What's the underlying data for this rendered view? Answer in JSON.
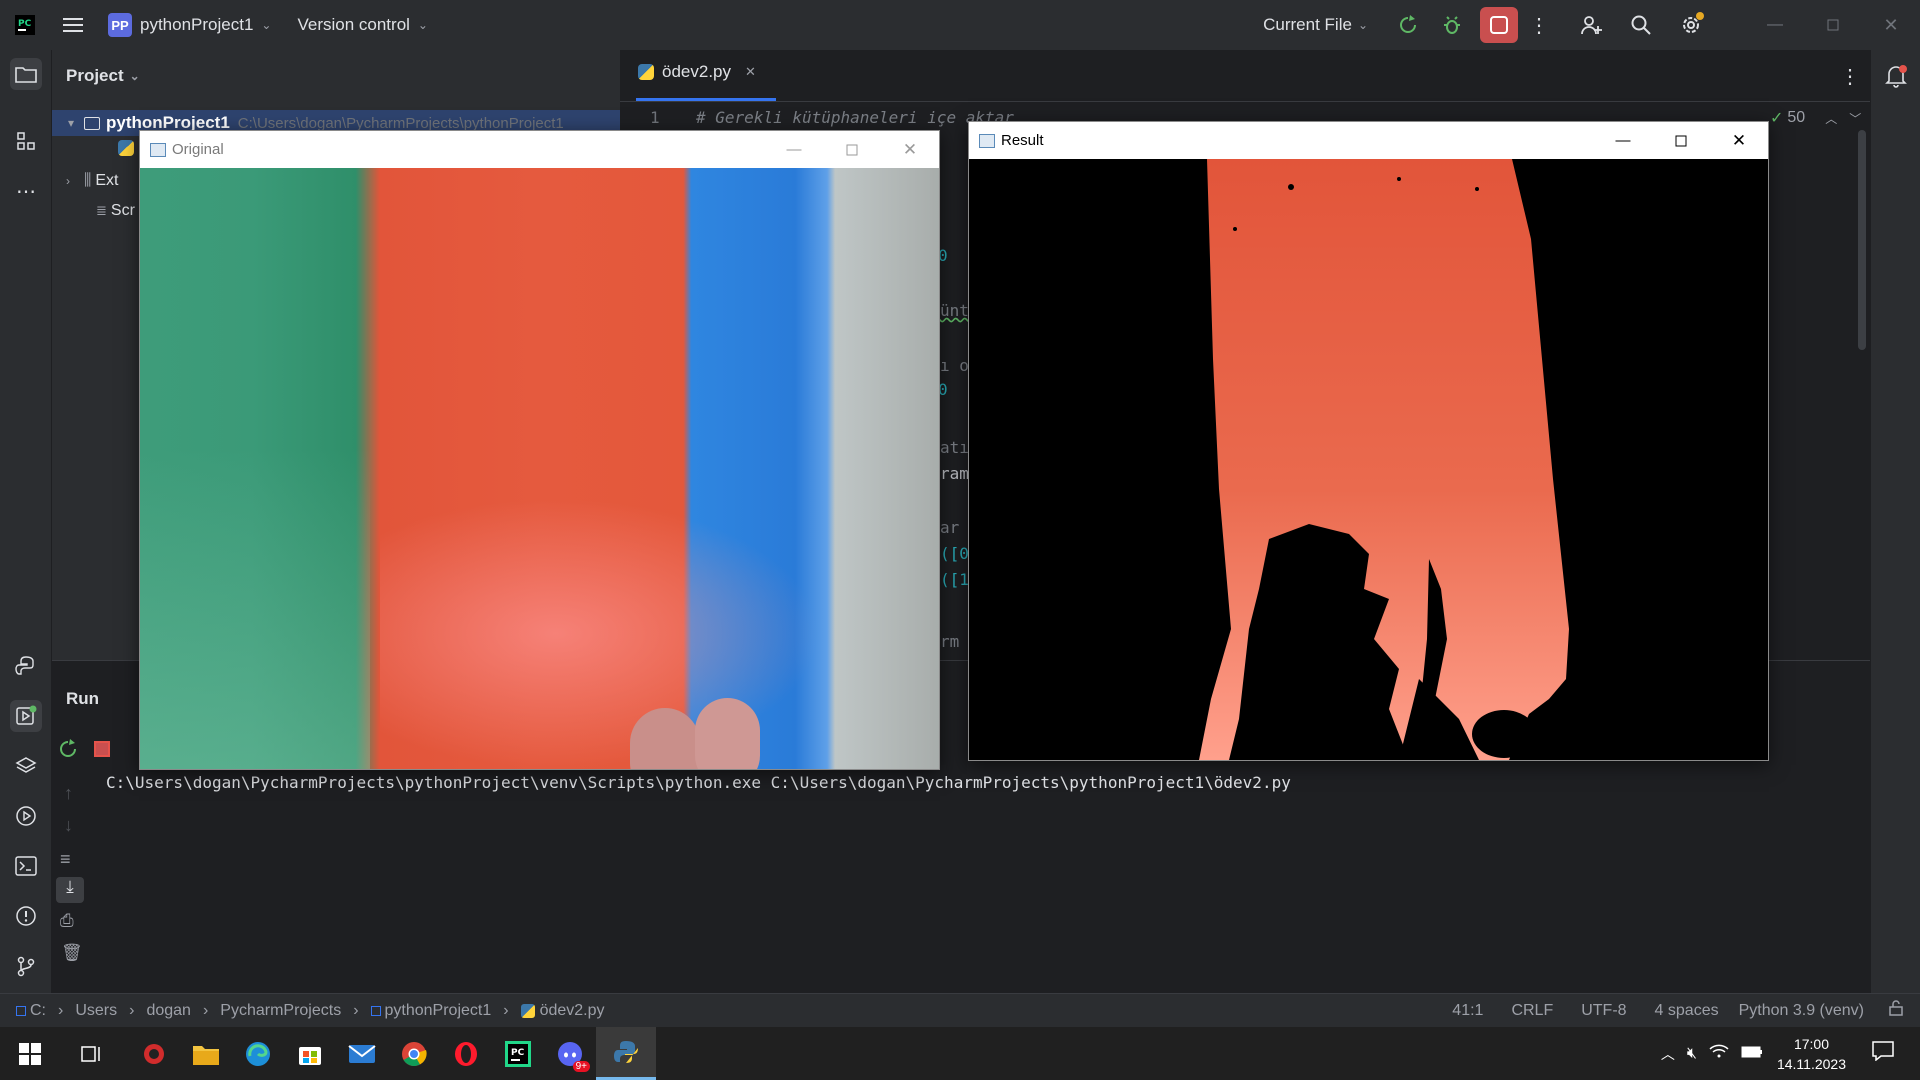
{
  "titlebar": {
    "project_badge": "PP",
    "project_name": "pythonProject1",
    "version_control": "Version control",
    "run_config": "Current File"
  },
  "project_panel": {
    "title": "Project",
    "root_name": "pythonProject1",
    "root_path": "C:\\Users\\dogan\\PycharmProjects\\pythonProject1",
    "ext_label": "Ext",
    "scr_label": "Scr"
  },
  "editor": {
    "tab_name": "ödev2.py",
    "line_number": "1",
    "code_line_1": "# Gerekli kütüphaneleri içe aktar",
    "inspection_count": "50",
    "fragments": [
      "0",
      "ünt",
      "ı o",
      "0",
      "atı",
      "ram",
      "ar",
      "([0",
      "([1",
      "rm"
    ]
  },
  "original_window": {
    "title": "Original"
  },
  "result_window": {
    "title": "Result"
  },
  "run_panel": {
    "tab_label": "Run",
    "command": "C:\\Users\\dogan\\PycharmProjects\\pythonProject\\venv\\Scripts\\python.exe C:\\Users\\dogan\\PycharmProjects\\pythonProject1\\ödev2.py"
  },
  "statusbar": {
    "crumbs": [
      "C:",
      "Users",
      "dogan",
      "PycharmProjects",
      "pythonProject1",
      "ödev2.py"
    ],
    "position": "41:1",
    "line_sep": "CRLF",
    "encoding": "UTF-8",
    "indent": "4 spaces",
    "interpreter": "Python 3.9 (venv)"
  },
  "taskbar": {
    "time": "17:00",
    "date": "14.11.2023",
    "discord_badge": "9+"
  },
  "colors": {
    "accent_red": "#c94f4f",
    "accent_green": "#5fb865",
    "bg_dark": "#1e1f22",
    "panel": "#2b2d30"
  }
}
